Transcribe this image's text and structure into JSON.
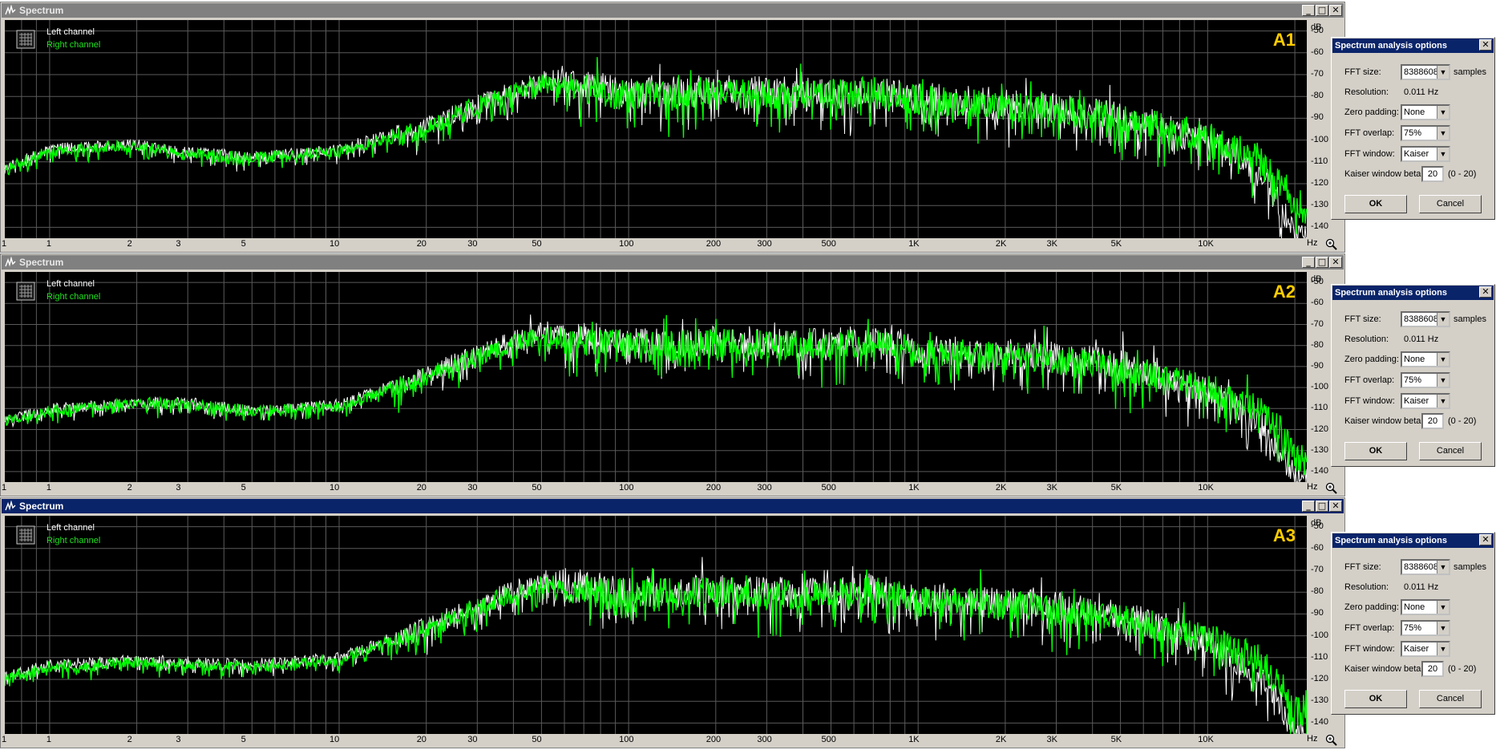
{
  "window_title": "Spectrum",
  "legend": {
    "left": "Left channel",
    "right": "Right channel"
  },
  "x_unit": "Hz",
  "y_unit": "dB",
  "x_ticks": [
    "1",
    "1",
    "2",
    "3",
    "5",
    "10",
    "20",
    "30",
    "50",
    "100",
    "200",
    "300",
    "500",
    "1K",
    "2K",
    "3K",
    "5K",
    "10K"
  ],
  "y_ticks": [
    "-50",
    "-60",
    "-70",
    "-80",
    "-90",
    "-100",
    "-110",
    "-120",
    "-130",
    "-140"
  ],
  "panels": [
    {
      "label": "A1",
      "active": false
    },
    {
      "label": "A2",
      "active": false
    },
    {
      "label": "A3",
      "active": true
    }
  ],
  "dialog": {
    "title": "Spectrum analysis options",
    "fft_size_label": "FFT size:",
    "fft_size_value": "8388608",
    "samples_label": "samples",
    "resolution_label": "Resolution:",
    "resolution_value": "0.011 Hz",
    "zero_padding_label": "Zero padding:",
    "zero_padding_value": "None",
    "fft_overlap_label": "FFT overlap:",
    "fft_overlap_value": "75%",
    "fft_window_label": "FFT window:",
    "fft_window_value": "Kaiser",
    "kaiser_label": "Kaiser window beta:",
    "kaiser_value": "20",
    "kaiser_range": "(0 - 20)",
    "ok_label": "OK",
    "cancel_label": "Cancel"
  },
  "colors": {
    "plot_background": "#000000",
    "grid": "#5a5a5a",
    "left_channel": "#ffffff",
    "right_channel": "#00ff00",
    "badge": "#ffcc00",
    "active_titlebar": "#0a246a",
    "inactive_titlebar": "#808080"
  },
  "chart_data": [
    {
      "type": "line",
      "title": "A1",
      "xlabel": "Hz",
      "ylabel": "dB",
      "x_scale": "log",
      "xlim": [
        0.7,
        22000
      ],
      "ylim": [
        -145,
        -45
      ],
      "grid": true,
      "legend_position": "top-left",
      "series": [
        {
          "name": "Left channel",
          "color": "#ffffff",
          "x": [
            0.7,
            1,
            2,
            3,
            5,
            10,
            20,
            30,
            50,
            70,
            100,
            200,
            300,
            500,
            700,
            1000,
            2000,
            3000,
            5000,
            10000,
            15000,
            18000,
            20000
          ],
          "y": [
            -112,
            -103,
            -101,
            -104,
            -107,
            -103,
            -92,
            -82,
            -70,
            -71,
            -76,
            -74,
            -75,
            -75,
            -74,
            -78,
            -80,
            -82,
            -86,
            -97,
            -110,
            -128,
            -140
          ]
        },
        {
          "name": "Right channel",
          "color": "#00ff00",
          "x": [
            0.7,
            1,
            2,
            3,
            5,
            10,
            20,
            30,
            50,
            70,
            100,
            200,
            300,
            500,
            700,
            1000,
            2000,
            3000,
            5000,
            10000,
            15000,
            18000,
            20000
          ],
          "y": [
            -112,
            -104,
            -101,
            -105,
            -107,
            -104,
            -93,
            -82,
            -72,
            -74,
            -77,
            -75,
            -76,
            -76,
            -75,
            -79,
            -81,
            -83,
            -87,
            -96,
            -105,
            -118,
            -130
          ]
        }
      ]
    },
    {
      "type": "line",
      "title": "A2",
      "xlabel": "Hz",
      "ylabel": "dB",
      "x_scale": "log",
      "xlim": [
        0.7,
        22000
      ],
      "ylim": [
        -145,
        -45
      ],
      "grid": true,
      "legend_position": "top-left",
      "series": [
        {
          "name": "Left channel",
          "color": "#ffffff",
          "x": [
            0.7,
            1,
            2,
            3,
            5,
            10,
            20,
            30,
            50,
            70,
            100,
            200,
            300,
            500,
            700,
            1000,
            2000,
            3000,
            5000,
            10000,
            15000,
            18000,
            20000
          ],
          "y": [
            -115,
            -109,
            -106,
            -106,
            -110,
            -107,
            -92,
            -82,
            -71,
            -72,
            -76,
            -75,
            -76,
            -76,
            -74,
            -79,
            -81,
            -82,
            -86,
            -98,
            -112,
            -128,
            -140
          ]
        },
        {
          "name": "Right channel",
          "color": "#00ff00",
          "x": [
            0.7,
            1,
            2,
            3,
            5,
            10,
            20,
            30,
            50,
            70,
            100,
            200,
            300,
            500,
            700,
            1000,
            2000,
            3000,
            5000,
            10000,
            15000,
            18000,
            20000
          ],
          "y": [
            -115,
            -110,
            -106,
            -107,
            -110,
            -108,
            -93,
            -83,
            -73,
            -75,
            -77,
            -76,
            -77,
            -77,
            -75,
            -80,
            -82,
            -84,
            -88,
            -97,
            -107,
            -118,
            -130
          ]
        }
      ]
    },
    {
      "type": "line",
      "title": "A3",
      "xlabel": "Hz",
      "ylabel": "dB",
      "x_scale": "log",
      "xlim": [
        0.7,
        22000
      ],
      "ylim": [
        -145,
        -45
      ],
      "grid": true,
      "legend_position": "top-left",
      "series": [
        {
          "name": "Left channel",
          "color": "#ffffff",
          "x": [
            0.7,
            1,
            2,
            3,
            5,
            10,
            20,
            30,
            50,
            70,
            100,
            200,
            300,
            500,
            700,
            1000,
            2000,
            3000,
            5000,
            10000,
            15000,
            18000,
            20000
          ],
          "y": [
            -118,
            -112,
            -110,
            -111,
            -112,
            -109,
            -94,
            -84,
            -72,
            -73,
            -77,
            -76,
            -77,
            -77,
            -75,
            -80,
            -82,
            -84,
            -88,
            -99,
            -114,
            -130,
            -142
          ]
        },
        {
          "name": "Right channel",
          "color": "#00ff00",
          "x": [
            0.7,
            1,
            2,
            3,
            5,
            10,
            20,
            30,
            50,
            70,
            100,
            200,
            300,
            500,
            700,
            1000,
            2000,
            3000,
            5000,
            10000,
            15000,
            18000,
            20000
          ],
          "y": [
            -118,
            -113,
            -111,
            -112,
            -113,
            -110,
            -95,
            -85,
            -74,
            -76,
            -78,
            -77,
            -78,
            -78,
            -76,
            -81,
            -83,
            -85,
            -89,
            -98,
            -108,
            -120,
            -132
          ]
        }
      ]
    }
  ]
}
